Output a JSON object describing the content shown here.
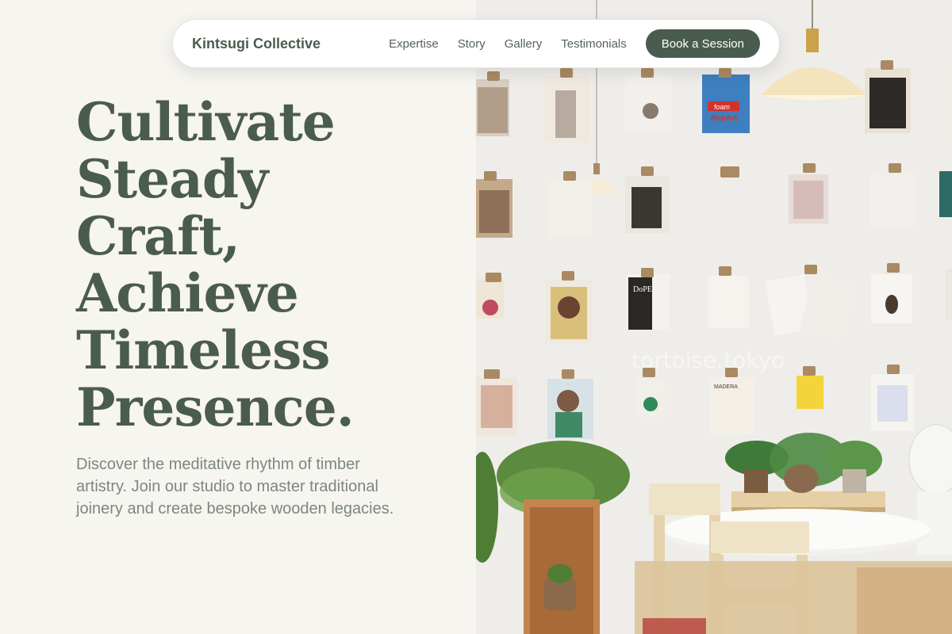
{
  "nav": {
    "brand": "Kintsugi Collective",
    "links": [
      "Expertise",
      "Story",
      "Gallery",
      "Testimonials"
    ],
    "cta": "Book a Session"
  },
  "hero": {
    "title_lines": [
      "Cultivate",
      "Steady",
      "Craft,",
      "Achieve",
      "Timeless",
      "Presence."
    ],
    "subtitle": "Discover the meditative rhythm of timber artistry. Join our studio to master traditional joinery and create bespoke wooden legacies."
  },
  "photo": {
    "watermark": "tortoise.tokyo",
    "magazine_labels": [
      "foam",
      "RepArt",
      "DoPE",
      "MADERA"
    ]
  },
  "colors": {
    "brand_green": "#4a5c4e",
    "page_bg": "#f7f5f0",
    "subtitle_gray": "#7d8680",
    "wall": "#ecebe8"
  }
}
